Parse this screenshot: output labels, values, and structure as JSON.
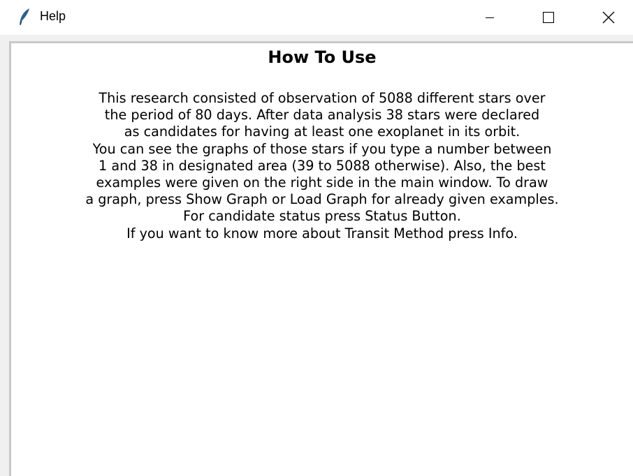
{
  "window": {
    "title": "Help",
    "controls": {
      "minimize_icon": "minimize-icon",
      "maximize_icon": "maximize-icon",
      "close_icon": "close-icon"
    },
    "app_icon": "feather-icon"
  },
  "content": {
    "heading": "How To Use",
    "lines": [
      "This research consisted of observation of 5088 different stars over",
      "the period of 80 days. After data analysis 38 stars were declared",
      "as candidates for having at least one exoplanet in its orbit.",
      "You can see the graphs of those stars if you type a number between",
      "1 and 38 in designated area (39 to 5088 otherwise). Also, the best",
      "examples were given on the right side in the main window. To draw",
      "a graph, press Show Graph or Load Graph for already given examples.",
      "For candidate status press Status Button.",
      "If you want to know more about Transit Method press Info."
    ]
  },
  "colors": {
    "titlebar_bg": "#ffffff",
    "window_bg": "#f0f0f0",
    "content_bg": "#ffffff",
    "text": "#000000",
    "icon": "#2e5f8a"
  }
}
